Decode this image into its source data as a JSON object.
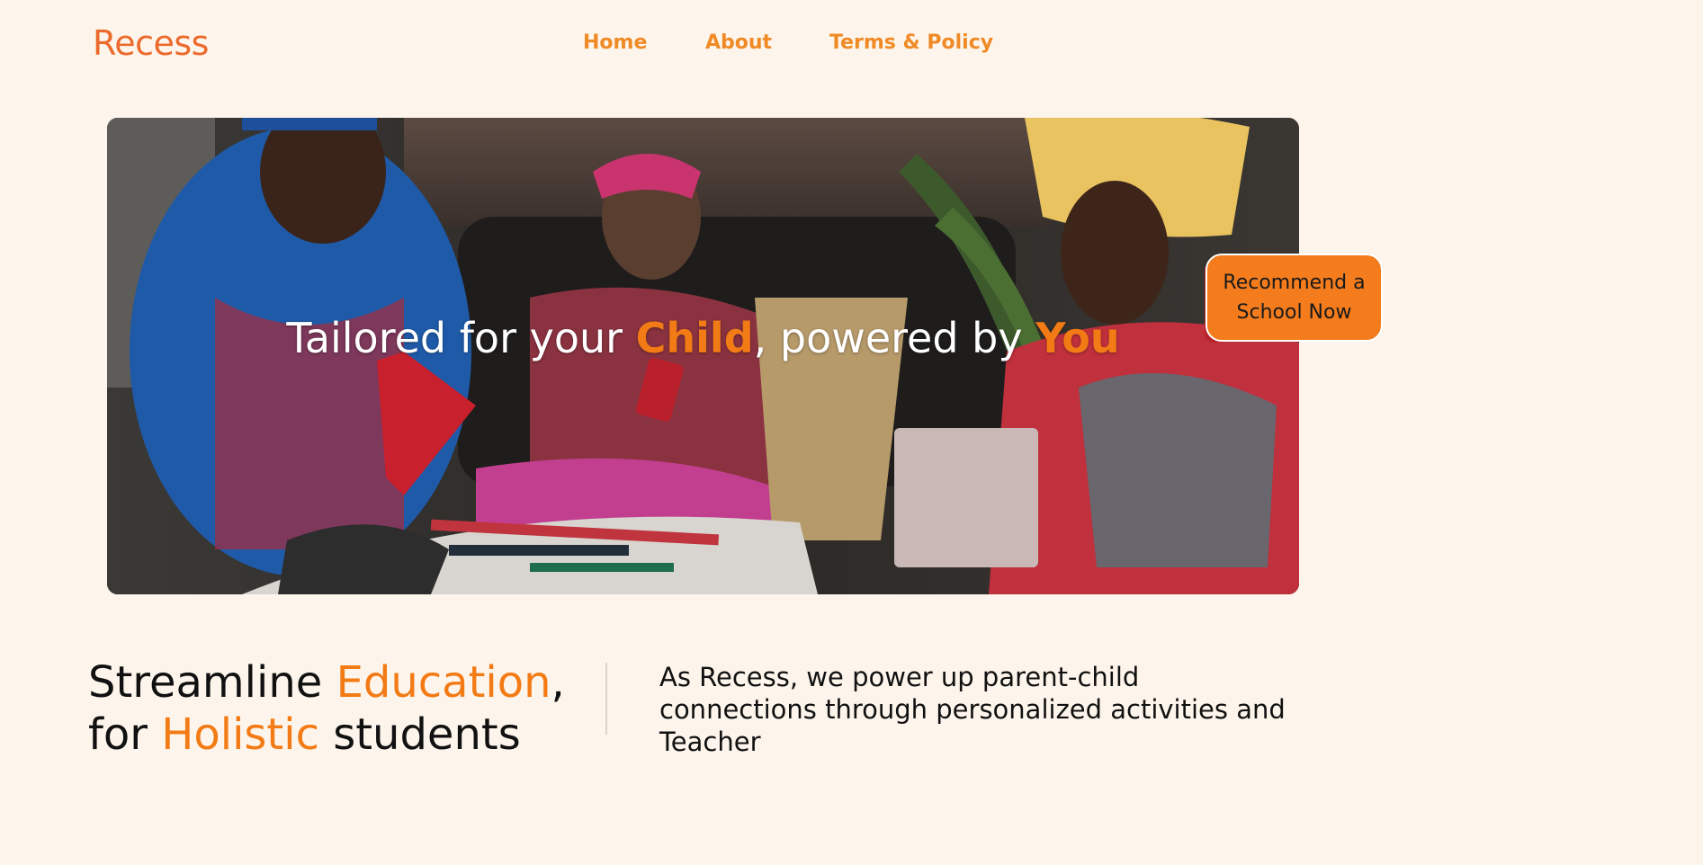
{
  "brand": {
    "logo_text": "Recess",
    "accent_color": "#f37b15"
  },
  "nav": {
    "items": [
      "Home",
      "About",
      "Terms & Policy"
    ]
  },
  "hero": {
    "title_part1": "Tailored for your ",
    "title_highlight1": "Child",
    "title_part2": ", powered by ",
    "title_highlight2": "You",
    "image_description_icon": "family-crafting-photo"
  },
  "cta": {
    "recommend_label": "Recommend a School Now"
  },
  "intro": {
    "heading_part1": "Streamline ",
    "heading_highlight1": "Education",
    "heading_part2": ",",
    "heading_line2_part1": "for ",
    "heading_highlight2": "Holistic",
    "heading_line2_part2": " students",
    "body": "As Recess, we power up parent-child connections through personalized activities and Teacher"
  }
}
